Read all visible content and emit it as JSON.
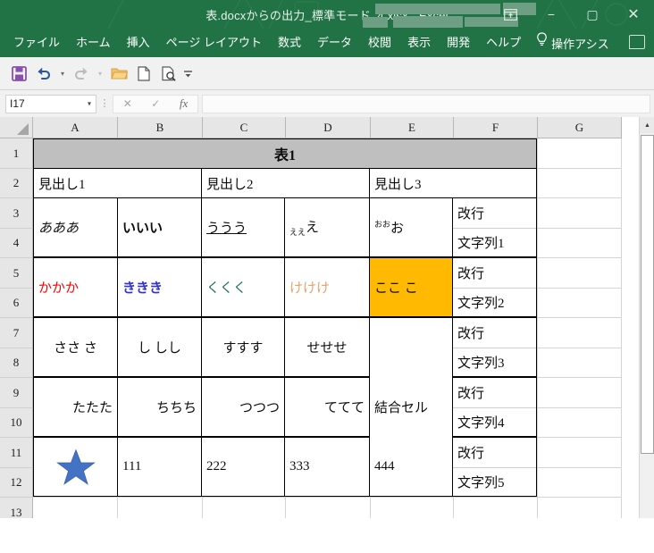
{
  "window": {
    "title": "表.docxからの出力_標準モード_4.xlsx  -  Excel",
    "ribbon_icon": "ribbon-display-options-icon",
    "minimize": "−",
    "maximize": "▢",
    "close": "✕"
  },
  "ribbon": {
    "tabs": [
      {
        "label": "ファイル"
      },
      {
        "label": "ホーム"
      },
      {
        "label": "挿入"
      },
      {
        "label": "ページ レイアウト"
      },
      {
        "label": "数式"
      },
      {
        "label": "データ"
      },
      {
        "label": "校閲"
      },
      {
        "label": "表示"
      },
      {
        "label": "開発"
      },
      {
        "label": "ヘルプ"
      }
    ],
    "tell_me": "操作アシス",
    "bulb_icon": "lightbulb-icon",
    "comment_icon": "comment-icon"
  },
  "quick_access": {
    "buttons": [
      {
        "name": "save-icon",
        "glyph": "save"
      },
      {
        "name": "undo-icon",
        "glyph": "undo"
      },
      {
        "name": "redo-icon",
        "glyph": "redo"
      },
      {
        "name": "open-folder-icon",
        "glyph": "folder"
      },
      {
        "name": "new-document-icon",
        "glyph": "page"
      },
      {
        "name": "print-preview-icon",
        "glyph": "preview"
      },
      {
        "name": "customize-toolbar-icon",
        "glyph": "caret"
      }
    ]
  },
  "formula_bar": {
    "name_box_value": "I17",
    "name_box_caret": "▾",
    "cancel_icon": "✕",
    "enter_icon": "✓",
    "fx_icon": "fx",
    "formula_value": "",
    "menu_dots": "⋮"
  },
  "grid": {
    "columns": [
      "A",
      "B",
      "C",
      "D",
      "E",
      "F",
      "G"
    ],
    "rows": [
      "1",
      "2",
      "3",
      "4",
      "5",
      "6",
      "7",
      "8",
      "9",
      "10",
      "11",
      "12",
      "13"
    ],
    "scrollbar": {
      "up_arrow": "▲"
    }
  },
  "table": {
    "title": "表1",
    "headers": [
      "見出し1",
      "見出し2",
      "見出し3"
    ],
    "rows": [
      {
        "a": "あああ",
        "b": "いいい",
        "c": "ううう",
        "d_small": "ええ",
        "d_main": "え",
        "e_small": "おお",
        "e_main": "お",
        "f_line1": "改行",
        "f_line2": "文字列1"
      },
      {
        "a": "かかか",
        "b": "ききき",
        "c": "くくく",
        "d": "けけけ",
        "e": "ここ こ",
        "f_line1": "改行",
        "f_line2": "文字列2"
      },
      {
        "a": "ささ さ",
        "b": "し しし",
        "c": "すすす",
        "d": "せせせ",
        "f_line1": "改行",
        "f_line2": "文字列3"
      },
      {
        "a": "たたた",
        "b": "ちちち",
        "c": "つつつ",
        "d": "ててて",
        "f_line1": "改行",
        "f_line2": "文字列4"
      },
      {
        "a": "",
        "b": "111",
        "c": "222",
        "d": "333",
        "e": "444",
        "f_line1": "改行",
        "f_line2": "文字列5"
      }
    ],
    "merged_cell_label": "結合セル",
    "star_shape": "star-shape",
    "colors": {
      "title_fill": "#bfbfbf",
      "highlight_fill": "#ffb900",
      "text_red": "#ff0000",
      "text_blue": "#3333cc",
      "text_teal": "#1f6f5c",
      "text_orange": "#e8a36a",
      "star_blue": "#4472c4",
      "accent_green": "#217346"
    }
  }
}
